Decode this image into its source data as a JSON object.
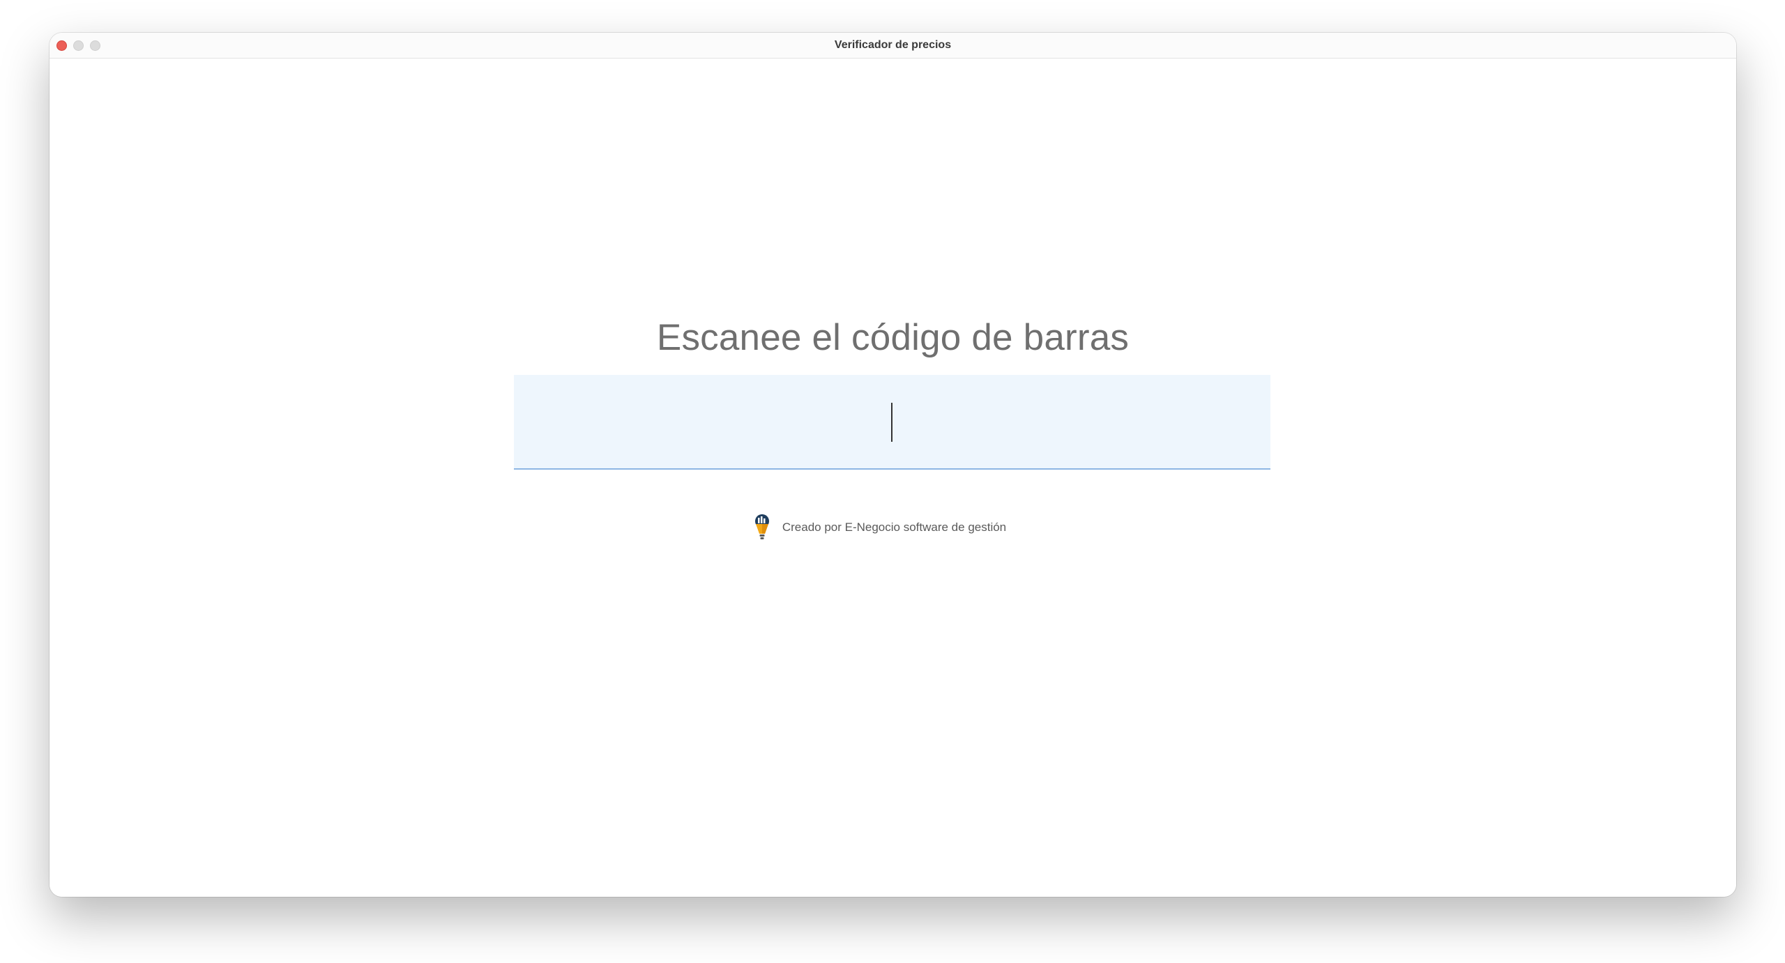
{
  "window": {
    "title": "Verificador de precios",
    "controls": {
      "close_color": "#ec5f57",
      "inactive_color": "#dcdcdc"
    }
  },
  "main": {
    "heading": "Escanee el código de barras",
    "barcode_input": {
      "value": "",
      "placeholder": "",
      "background_color": "#eef6fd",
      "underline_color": "#8db6e4"
    },
    "credit": {
      "logo_icon": "lightbulb-logo-icon",
      "text": "Creado por E-Negocio software de gestión"
    }
  }
}
